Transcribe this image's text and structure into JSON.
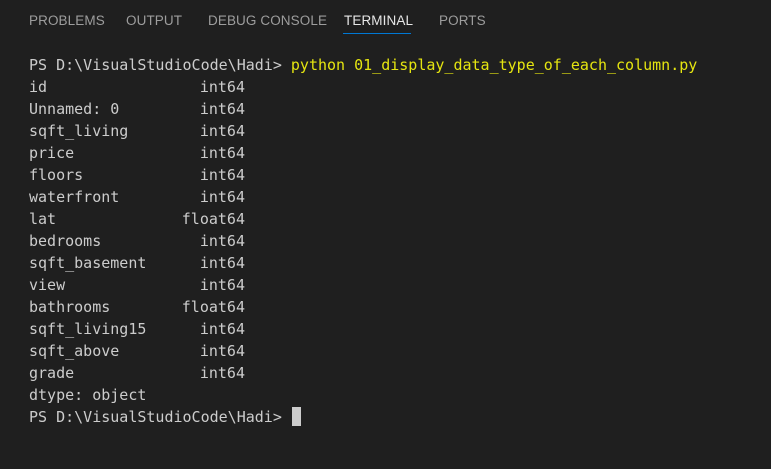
{
  "tabs": [
    {
      "label": "PROBLEMS",
      "active": false
    },
    {
      "label": "OUTPUT",
      "active": false
    },
    {
      "label": "DEBUG CONSOLE",
      "active": false
    },
    {
      "label": "TERMINAL",
      "active": true
    },
    {
      "label": "PORTS",
      "active": false
    }
  ],
  "terminal": {
    "prompt": "PS D:\\VisualStudioCode\\Hadi> ",
    "command": "python 01_display_data_type_of_each_column.py",
    "rows": [
      {
        "name": "id",
        "type": "int64"
      },
      {
        "name": "Unnamed: 0",
        "type": "int64"
      },
      {
        "name": "sqft_living",
        "type": "int64"
      },
      {
        "name": "price",
        "type": "int64"
      },
      {
        "name": "floors",
        "type": "int64"
      },
      {
        "name": "waterfront",
        "type": "int64"
      },
      {
        "name": "lat",
        "type": "float64"
      },
      {
        "name": "bedrooms",
        "type": "int64"
      },
      {
        "name": "sqft_basement",
        "type": "int64"
      },
      {
        "name": "view",
        "type": "int64"
      },
      {
        "name": "bathrooms",
        "type": "float64"
      },
      {
        "name": "sqft_living15",
        "type": "int64"
      },
      {
        "name": "sqft_above",
        "type": "int64"
      },
      {
        "name": "grade",
        "type": "int64"
      }
    ],
    "dtype_line": "dtype: object",
    "final_prompt": "PS D:\\VisualStudioCode\\Hadi> "
  },
  "colors": {
    "background": "#1f1f1f",
    "text": "#cccccc",
    "command": "#e5e510",
    "tab_inactive": "#9d9d9d",
    "tab_active": "#e7e7e7",
    "tab_accent": "#0078d4"
  }
}
